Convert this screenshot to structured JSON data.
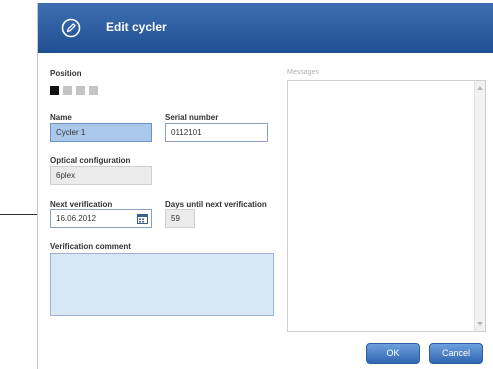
{
  "dialog": {
    "title": "Edit cycler",
    "icon": "edit-pencil-icon"
  },
  "position": {
    "label": "Position",
    "slots": [
      {
        "selected": true
      },
      {
        "selected": false
      },
      {
        "selected": false
      },
      {
        "selected": false
      }
    ]
  },
  "name": {
    "label": "Name",
    "value": "Cycler 1"
  },
  "serial": {
    "label": "Serial number",
    "value": "0112101"
  },
  "optical": {
    "label": "Optical configuration",
    "value": "6plex"
  },
  "next_verification": {
    "label": "Next verification",
    "value": "16.06.2012",
    "icon": "calendar-icon"
  },
  "days_until": {
    "label": "Days until next verification",
    "value": "59"
  },
  "comment": {
    "label": "Verification comment",
    "value": ""
  },
  "messages": {
    "label": "Messages"
  },
  "buttons": {
    "ok": "OK",
    "cancel": "Cancel"
  },
  "colors": {
    "title_bar": "#2a5a9e",
    "active_field": "#a9c8ea",
    "comment_field": "#d8e7f6",
    "button": "#3f74bd"
  }
}
